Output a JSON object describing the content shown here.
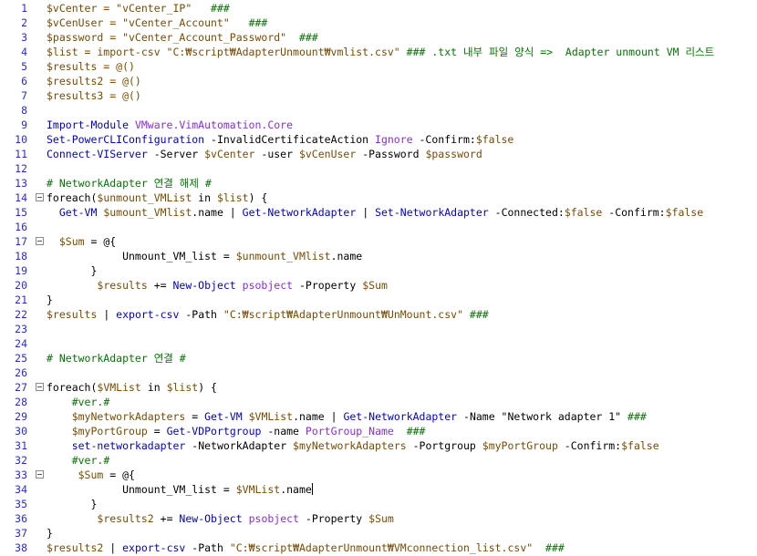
{
  "editor": {
    "colors": {
      "line_numbers": "#2b2bd6",
      "comment": "#007800",
      "variable": "#7a4b00",
      "command": "#0000cc",
      "type": "#8a2be2"
    },
    "lines": [
      {
        "n": "1",
        "fold": false,
        "segs": [
          {
            "c": "var",
            "t": "$vCenter = \"vCenter_IP\"   "
          },
          {
            "c": "cmt",
            "t": "###"
          }
        ]
      },
      {
        "n": "2",
        "fold": false,
        "segs": [
          {
            "c": "var",
            "t": "$vCenUser = \"vCenter_Account\"   "
          },
          {
            "c": "cmt",
            "t": "###"
          }
        ]
      },
      {
        "n": "3",
        "fold": false,
        "segs": [
          {
            "c": "var",
            "t": "$password = \"vCenter_Account_Password\"  "
          },
          {
            "c": "cmt",
            "t": "###"
          }
        ]
      },
      {
        "n": "4",
        "fold": false,
        "segs": [
          {
            "c": "var",
            "t": "$list = import-csv \"C:₩script₩AdapterUnmount₩vmlist.csv\" "
          },
          {
            "c": "cmt",
            "t": "### .txt 내부 파일 양식 =>  Adapter unmount VM 리스트"
          }
        ]
      },
      {
        "n": "5",
        "fold": false,
        "segs": [
          {
            "c": "var",
            "t": "$results = @()"
          }
        ]
      },
      {
        "n": "6",
        "fold": false,
        "segs": [
          {
            "c": "var",
            "t": "$results2 = @()"
          }
        ]
      },
      {
        "n": "7",
        "fold": false,
        "segs": [
          {
            "c": "var",
            "t": "$results3 = @()"
          }
        ]
      },
      {
        "n": "8",
        "fold": false,
        "segs": []
      },
      {
        "n": "9",
        "fold": false,
        "segs": [
          {
            "c": "cmd",
            "t": "Import-Module "
          },
          {
            "c": "type",
            "t": "VMware.VimAutomation.Core"
          }
        ]
      },
      {
        "n": "10",
        "fold": false,
        "segs": [
          {
            "c": "cmd",
            "t": "Set-PowerCLIConfiguration "
          },
          {
            "c": "default",
            "t": "-InvalidCertificateAction "
          },
          {
            "c": "type",
            "t": "Ignore "
          },
          {
            "c": "default",
            "t": "-Confirm:"
          },
          {
            "c": "var",
            "t": "$false"
          }
        ]
      },
      {
        "n": "11",
        "fold": false,
        "segs": [
          {
            "c": "cmd",
            "t": "Connect-VIServer "
          },
          {
            "c": "default",
            "t": "-Server "
          },
          {
            "c": "var",
            "t": "$vCenter "
          },
          {
            "c": "default",
            "t": "-user "
          },
          {
            "c": "var",
            "t": "$vCenUser "
          },
          {
            "c": "default",
            "t": "-Password "
          },
          {
            "c": "var",
            "t": "$password"
          }
        ]
      },
      {
        "n": "12",
        "fold": false,
        "segs": []
      },
      {
        "n": "13",
        "fold": false,
        "segs": [
          {
            "c": "cmt",
            "t": "# NetworkAdapter 연결 해제 #"
          }
        ]
      },
      {
        "n": "14",
        "fold": true,
        "segs": [
          {
            "c": "default",
            "t": "foreach("
          },
          {
            "c": "var",
            "t": "$unmount_VMList "
          },
          {
            "c": "default",
            "t": "in "
          },
          {
            "c": "var",
            "t": "$list"
          },
          {
            "c": "default",
            "t": ") {"
          }
        ]
      },
      {
        "n": "15",
        "fold": false,
        "segs": [
          {
            "c": "default",
            "t": "  "
          },
          {
            "c": "cmd",
            "t": "Get-VM "
          },
          {
            "c": "var",
            "t": "$umount_VMlist"
          },
          {
            "c": "default",
            "t": ".name | "
          },
          {
            "c": "cmd",
            "t": "Get-NetworkAdapter "
          },
          {
            "c": "default",
            "t": "| "
          },
          {
            "c": "cmd",
            "t": "Set-NetworkAdapter "
          },
          {
            "c": "default",
            "t": "-Connected:"
          },
          {
            "c": "var",
            "t": "$false "
          },
          {
            "c": "default",
            "t": "-Confirm:"
          },
          {
            "c": "var",
            "t": "$false"
          }
        ]
      },
      {
        "n": "16",
        "fold": false,
        "segs": []
      },
      {
        "n": "17",
        "fold": true,
        "segs": [
          {
            "c": "default",
            "t": "  "
          },
          {
            "c": "var",
            "t": "$Sum "
          },
          {
            "c": "default",
            "t": "= @{"
          }
        ]
      },
      {
        "n": "18",
        "fold": false,
        "segs": [
          {
            "c": "default",
            "t": "            Unmount_VM_list = "
          },
          {
            "c": "var",
            "t": "$unmount_VMlist"
          },
          {
            "c": "default",
            "t": ".name"
          }
        ]
      },
      {
        "n": "19",
        "fold": false,
        "segs": [
          {
            "c": "default",
            "t": "       }"
          }
        ]
      },
      {
        "n": "20",
        "fold": false,
        "segs": [
          {
            "c": "default",
            "t": "        "
          },
          {
            "c": "var",
            "t": "$results "
          },
          {
            "c": "default",
            "t": "+= "
          },
          {
            "c": "cmd",
            "t": "New-Object "
          },
          {
            "c": "type",
            "t": "psobject "
          },
          {
            "c": "default",
            "t": "-Property "
          },
          {
            "c": "var",
            "t": "$Sum"
          }
        ]
      },
      {
        "n": "21",
        "fold": false,
        "segs": [
          {
            "c": "default",
            "t": "}"
          }
        ]
      },
      {
        "n": "22",
        "fold": false,
        "segs": [
          {
            "c": "var",
            "t": "$results "
          },
          {
            "c": "default",
            "t": "| "
          },
          {
            "c": "cmd",
            "t": "export-csv "
          },
          {
            "c": "default",
            "t": "-Path "
          },
          {
            "c": "str",
            "t": "\"C:₩script₩AdapterUnmount₩UnMount.csv\" "
          },
          {
            "c": "cmt",
            "t": "###"
          }
        ]
      },
      {
        "n": "23",
        "fold": false,
        "segs": []
      },
      {
        "n": "24",
        "fold": false,
        "segs": []
      },
      {
        "n": "25",
        "fold": false,
        "segs": [
          {
            "c": "cmt",
            "t": "# NetworkAdapter 연결 #"
          }
        ]
      },
      {
        "n": "26",
        "fold": false,
        "segs": []
      },
      {
        "n": "27",
        "fold": true,
        "segs": [
          {
            "c": "default",
            "t": "foreach("
          },
          {
            "c": "var",
            "t": "$VMList "
          },
          {
            "c": "default",
            "t": "in "
          },
          {
            "c": "var",
            "t": "$list"
          },
          {
            "c": "default",
            "t": ") {"
          }
        ]
      },
      {
        "n": "28",
        "fold": false,
        "segs": [
          {
            "c": "default",
            "t": "    "
          },
          {
            "c": "cmt",
            "t": "#ver.#"
          }
        ]
      },
      {
        "n": "29",
        "fold": false,
        "segs": [
          {
            "c": "default",
            "t": "    "
          },
          {
            "c": "var",
            "t": "$myNetworkAdapters "
          },
          {
            "c": "default",
            "t": "= "
          },
          {
            "c": "cmd",
            "t": "Get-VM "
          },
          {
            "c": "var",
            "t": "$VMList"
          },
          {
            "c": "default",
            "t": ".name | "
          },
          {
            "c": "cmd",
            "t": "Get-NetworkAdapter "
          },
          {
            "c": "default",
            "t": "-Name \"Network adapter 1\" "
          },
          {
            "c": "cmt",
            "t": "###"
          }
        ]
      },
      {
        "n": "30",
        "fold": false,
        "segs": [
          {
            "c": "default",
            "t": "    "
          },
          {
            "c": "var",
            "t": "$myPortGroup "
          },
          {
            "c": "default",
            "t": "= "
          },
          {
            "c": "cmd",
            "t": "Get-VDPortgroup "
          },
          {
            "c": "default",
            "t": "-name "
          },
          {
            "c": "type",
            "t": "PortGroup_Name  "
          },
          {
            "c": "cmt",
            "t": "###"
          }
        ]
      },
      {
        "n": "31",
        "fold": false,
        "segs": [
          {
            "c": "default",
            "t": "    "
          },
          {
            "c": "cmd",
            "t": "set-networkadapter "
          },
          {
            "c": "default",
            "t": "-NetworkAdapter "
          },
          {
            "c": "var",
            "t": "$myNetworkAdapters "
          },
          {
            "c": "default",
            "t": "-Portgroup "
          },
          {
            "c": "var",
            "t": "$myPortGroup "
          },
          {
            "c": "default",
            "t": "-Confirm:"
          },
          {
            "c": "var",
            "t": "$false"
          }
        ]
      },
      {
        "n": "32",
        "fold": false,
        "segs": [
          {
            "c": "default",
            "t": "    "
          },
          {
            "c": "cmt",
            "t": "#ver.#"
          }
        ]
      },
      {
        "n": "33",
        "fold": true,
        "segs": [
          {
            "c": "default",
            "t": "     "
          },
          {
            "c": "var",
            "t": "$Sum "
          },
          {
            "c": "default",
            "t": "= @{"
          }
        ]
      },
      {
        "n": "34",
        "fold": false,
        "segs": [
          {
            "c": "default",
            "t": "            Unmount_VM_list = "
          },
          {
            "c": "var",
            "t": "$VMList"
          },
          {
            "c": "default",
            "t": ".name"
          }
        ],
        "caret": true
      },
      {
        "n": "35",
        "fold": false,
        "segs": [
          {
            "c": "default",
            "t": "       }"
          }
        ]
      },
      {
        "n": "36",
        "fold": false,
        "segs": [
          {
            "c": "default",
            "t": "        "
          },
          {
            "c": "var",
            "t": "$results2 "
          },
          {
            "c": "default",
            "t": "+= "
          },
          {
            "c": "cmd",
            "t": "New-Object "
          },
          {
            "c": "type",
            "t": "psobject "
          },
          {
            "c": "default",
            "t": "-Property "
          },
          {
            "c": "var",
            "t": "$Sum"
          }
        ]
      },
      {
        "n": "37",
        "fold": false,
        "segs": [
          {
            "c": "default",
            "t": "}"
          }
        ]
      },
      {
        "n": "38",
        "fold": false,
        "segs": [
          {
            "c": "var",
            "t": "$results2 "
          },
          {
            "c": "default",
            "t": "| "
          },
          {
            "c": "cmd",
            "t": "export-csv "
          },
          {
            "c": "default",
            "t": "-Path "
          },
          {
            "c": "str",
            "t": "\"C:₩script₩AdapterUnmount₩VMconnection_list.csv\"  "
          },
          {
            "c": "cmt",
            "t": "###"
          }
        ]
      }
    ]
  }
}
